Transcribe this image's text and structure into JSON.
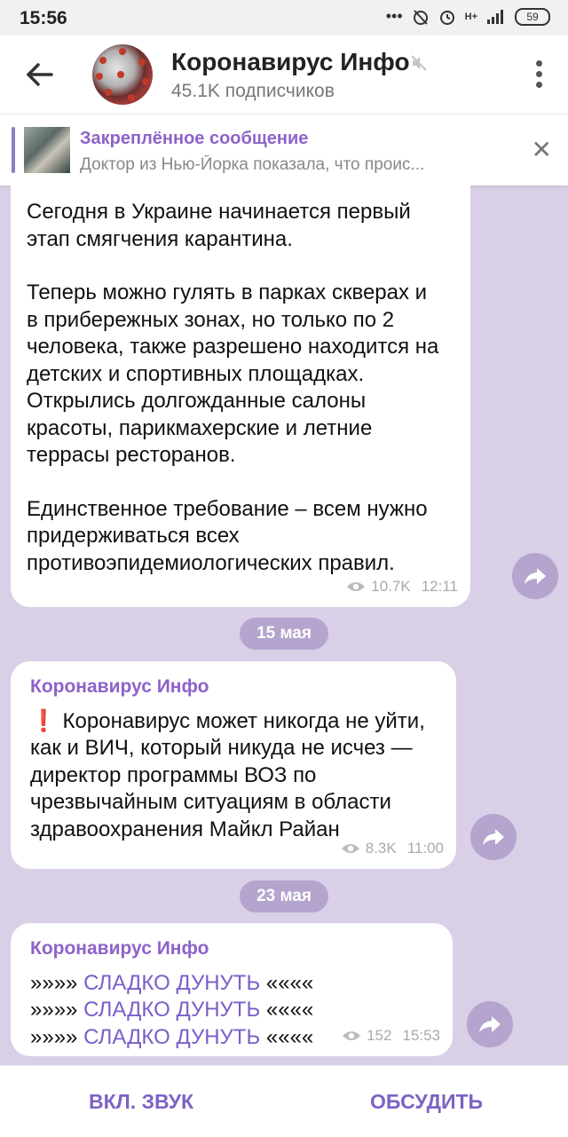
{
  "status_bar": {
    "time": "15:56",
    "network_label": "H+",
    "battery": "59"
  },
  "header": {
    "title": "Коронавирус Инфо",
    "subtitle": "45.1K подписчиков"
  },
  "pinned": {
    "title": "Закреплённое сообщение",
    "text": "Доктор из Нью-Йорка показала, что проис..."
  },
  "messages": [
    {
      "paragraphs": [
        "Сегодня в Украине начинается первый этап смягчения карантина.",
        "Теперь можно гулять в парках скверах и в прибережных зонах, но только по 2 человека, также разрешено находится на детских и спортивных площадках. Открылись долгожданные салоны красоты, парикмахерские и летние террасы ресторанов.",
        "Единственное требование – всем нужно придерживаться всех противоэпидемиологических правил."
      ],
      "views": "10.7K",
      "time": "12:11"
    },
    {
      "date": "15 мая",
      "sender": "Коронавирус Инфо",
      "text": "❗ Коронавирус может никогда не уйти, как и ВИЧ, который никуда не исчез — директор программы ВОЗ по чрезвычайным ситуациям в области здравоохранения Майкл Райан",
      "views": "8.3K",
      "time": "11:00"
    },
    {
      "date": "23 мая",
      "sender": "Коронавирус Инфо",
      "lines": [
        {
          "prefix": "»»»» ",
          "link": "СЛАДКО ДУНУТЬ",
          "suffix": " ««««"
        },
        {
          "prefix": "»»»» ",
          "link": "СЛАДКО ДУНУТЬ",
          "suffix": " ««««"
        },
        {
          "prefix": "»»»» ",
          "link": "СЛАДКО ДУНУТЬ",
          "suffix": " ««««"
        }
      ],
      "views": "152",
      "time": "15:53"
    }
  ],
  "bottom": {
    "sound_label": "ВКЛ. ЗВУК",
    "discuss_label": "ОБСУДИТЬ"
  },
  "colors": {
    "accent": "#8e62c9",
    "background": "#d9cfe6"
  }
}
